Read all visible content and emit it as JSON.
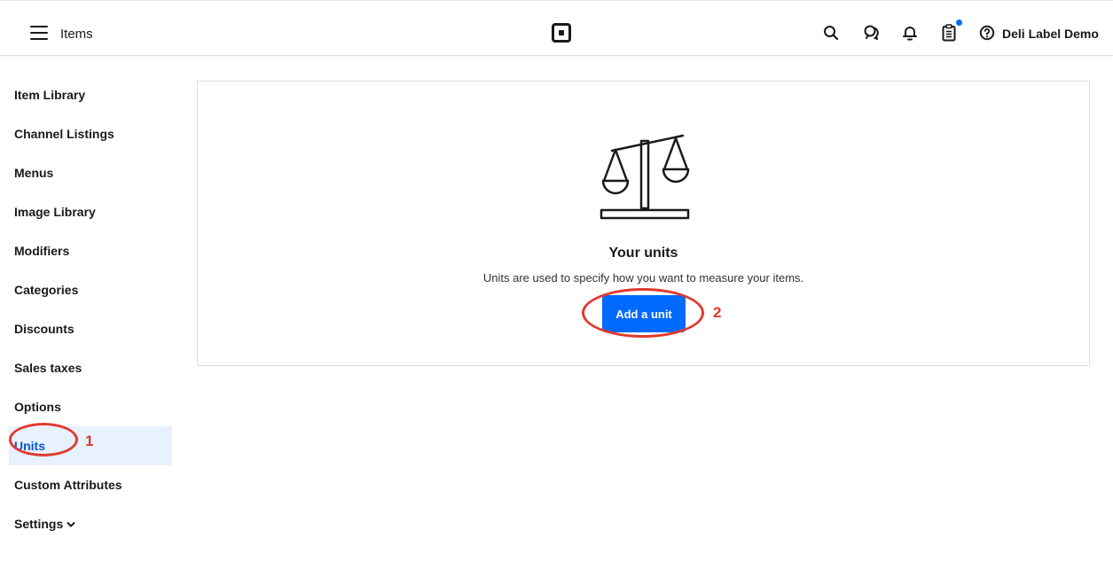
{
  "header": {
    "title": "Items",
    "account_name": "Deli Label Demo",
    "icons": [
      "menu-icon",
      "square-logo-icon",
      "search-icon",
      "messages-icon",
      "bell-icon",
      "clipboard-icon",
      "help-icon"
    ]
  },
  "sidebar": {
    "items": [
      {
        "label": "Item Library"
      },
      {
        "label": "Channel Listings"
      },
      {
        "label": "Menus"
      },
      {
        "label": "Image Library"
      },
      {
        "label": "Modifiers"
      },
      {
        "label": "Categories"
      },
      {
        "label": "Discounts"
      },
      {
        "label": "Sales taxes"
      },
      {
        "label": "Options"
      },
      {
        "label": "Units"
      },
      {
        "label": "Custom Attributes"
      },
      {
        "label": "Settings"
      }
    ],
    "active": "Units"
  },
  "empty_state": {
    "icon": "balance-scale-icon",
    "title": "Your units",
    "description": "Units are used to specify how you want to measure your items.",
    "button_label": "Add a unit"
  },
  "annotations": {
    "step1": "1",
    "step2": "2"
  },
  "colors": {
    "accent": "#006aff",
    "active_bg": "#e8f1fe",
    "active_text": "#0055d4",
    "annotation": "#e03a2f"
  }
}
